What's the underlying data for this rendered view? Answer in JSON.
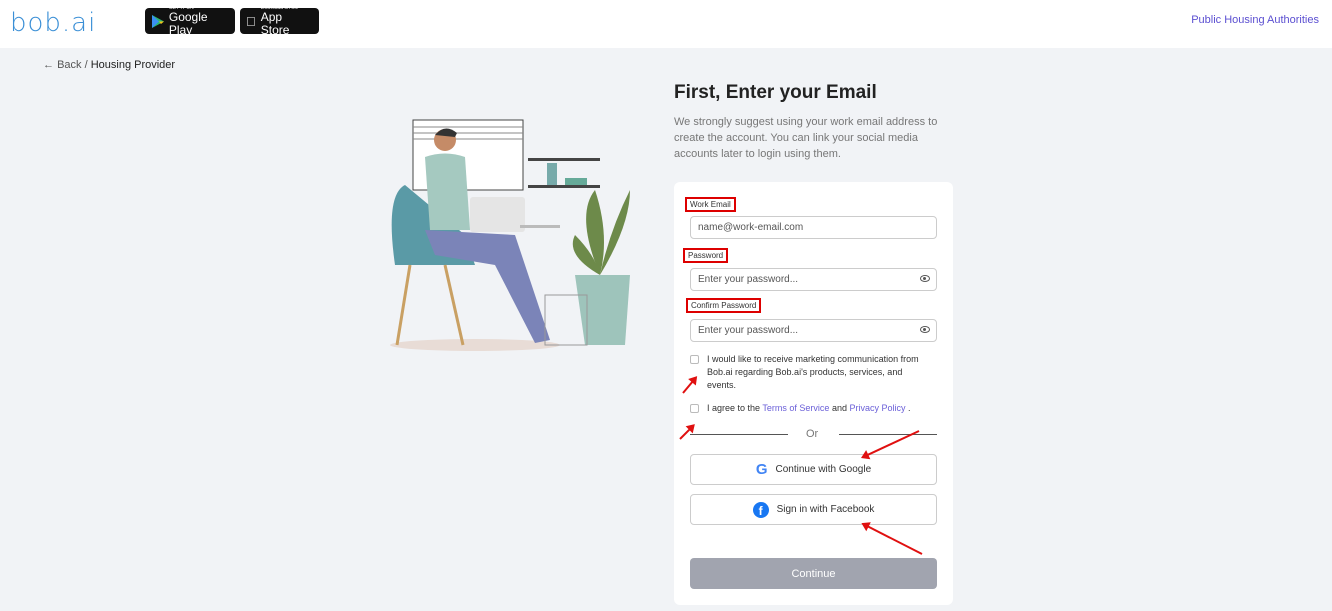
{
  "header": {
    "logo": "bob.ai",
    "google_play": {
      "small": "GET IT ON",
      "big": "Google Play"
    },
    "app_store": {
      "small": "Download on the",
      "big": "App Store"
    },
    "link": "Public Housing Authorities"
  },
  "breadcrumb": {
    "back": "Back /",
    "current": "Housing Provider"
  },
  "page": {
    "title": "First, Enter your Email",
    "subtitle": "We strongly suggest using your work email address to create the account. You can link your social media accounts later to login using them."
  },
  "form": {
    "email_label": "Work Email",
    "email_placeholder": "name@work-email.com",
    "password_label": "Password",
    "password_placeholder": "Enter your password...",
    "confirm_label": "Confirm Password",
    "confirm_placeholder": "Enter your password...",
    "marketing": "I would like to receive marketing communication from Bob.ai regarding Bob.ai's products, services, and events.",
    "terms_pre": "I agree to the",
    "terms_link": "Terms of Service",
    "terms_and": "and",
    "privacy_link": "Privacy Policy",
    "terms_post": ".",
    "or": "Or",
    "google": "Continue with Google",
    "facebook": "Sign in with Facebook",
    "continue": "Continue"
  },
  "colors": {
    "accent": "#5b4fd1",
    "annotation": "#e01010",
    "continue_disabled": "#a1a4af"
  }
}
